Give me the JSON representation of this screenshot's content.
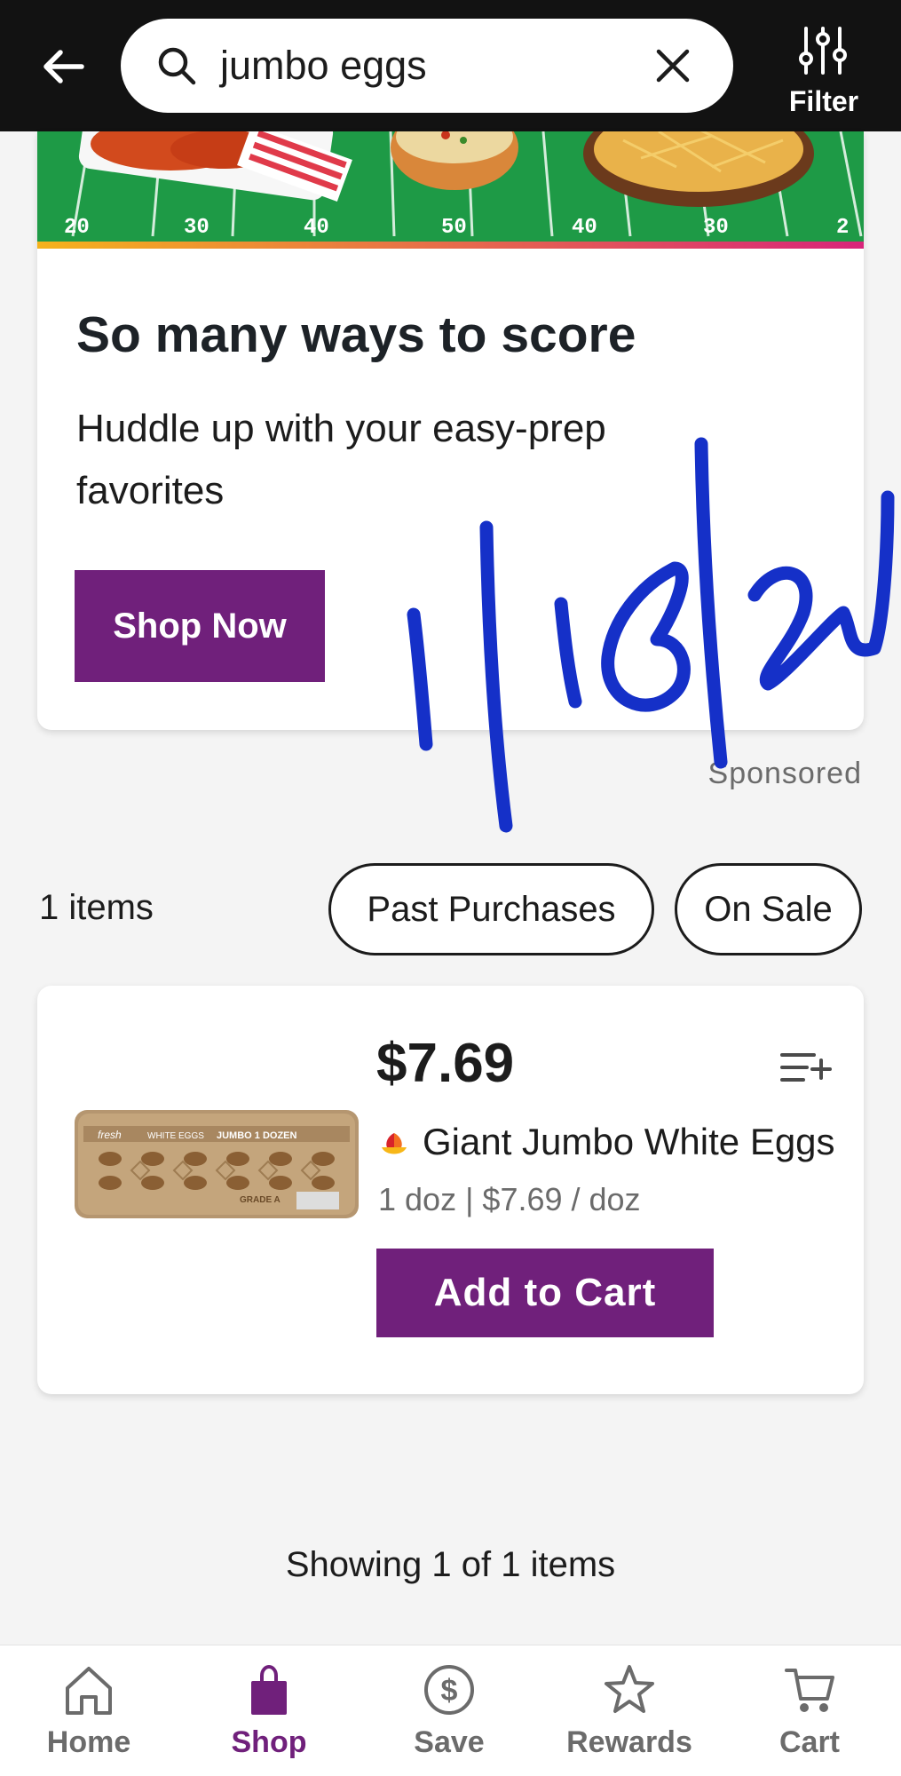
{
  "header": {
    "search": {
      "value": "jumbo eggs"
    },
    "filter_label": "Filter"
  },
  "promo": {
    "banner_field_numbers": [
      "20",
      "30",
      "40",
      "50",
      "40",
      "30",
      "2"
    ],
    "title": "So many ways to score",
    "subtitle": "Huddle up with your easy-prep favorites",
    "button_label": "Shop Now",
    "sponsored_label": "Sponsored"
  },
  "annotation": {
    "handwriting": "1|15|25"
  },
  "results": {
    "count_label": "1 items",
    "chips": [
      {
        "label": "Past Purchases"
      },
      {
        "label": "On Sale"
      }
    ]
  },
  "product": {
    "price": "$7.69",
    "name": "Giant Jumbo White Eggs",
    "size_price": "1 doz | $7.69 / doz",
    "add_button_label": "Add to Cart",
    "package_text": {
      "brand": "fresh",
      "type": "WHITE EGGS",
      "size": "JUMBO 1 DOZEN",
      "grade": "GRADE A"
    }
  },
  "footer": {
    "showing_label": "Showing 1 of 1 items"
  },
  "bottom_nav": {
    "items": [
      {
        "label": "Home",
        "icon": "home-icon",
        "active": false
      },
      {
        "label": "Shop",
        "icon": "shopping-bag-icon",
        "active": true
      },
      {
        "label": "Save",
        "icon": "dollar-circle-icon",
        "active": false
      },
      {
        "label": "Rewards",
        "icon": "star-icon",
        "active": false
      },
      {
        "label": "Cart",
        "icon": "cart-icon",
        "active": false
      }
    ]
  },
  "colors": {
    "header_bg": "#121212",
    "brand_purple": "#70207b",
    "handwriting_blue": "#1530c8",
    "field_green": "#1e9a46"
  }
}
